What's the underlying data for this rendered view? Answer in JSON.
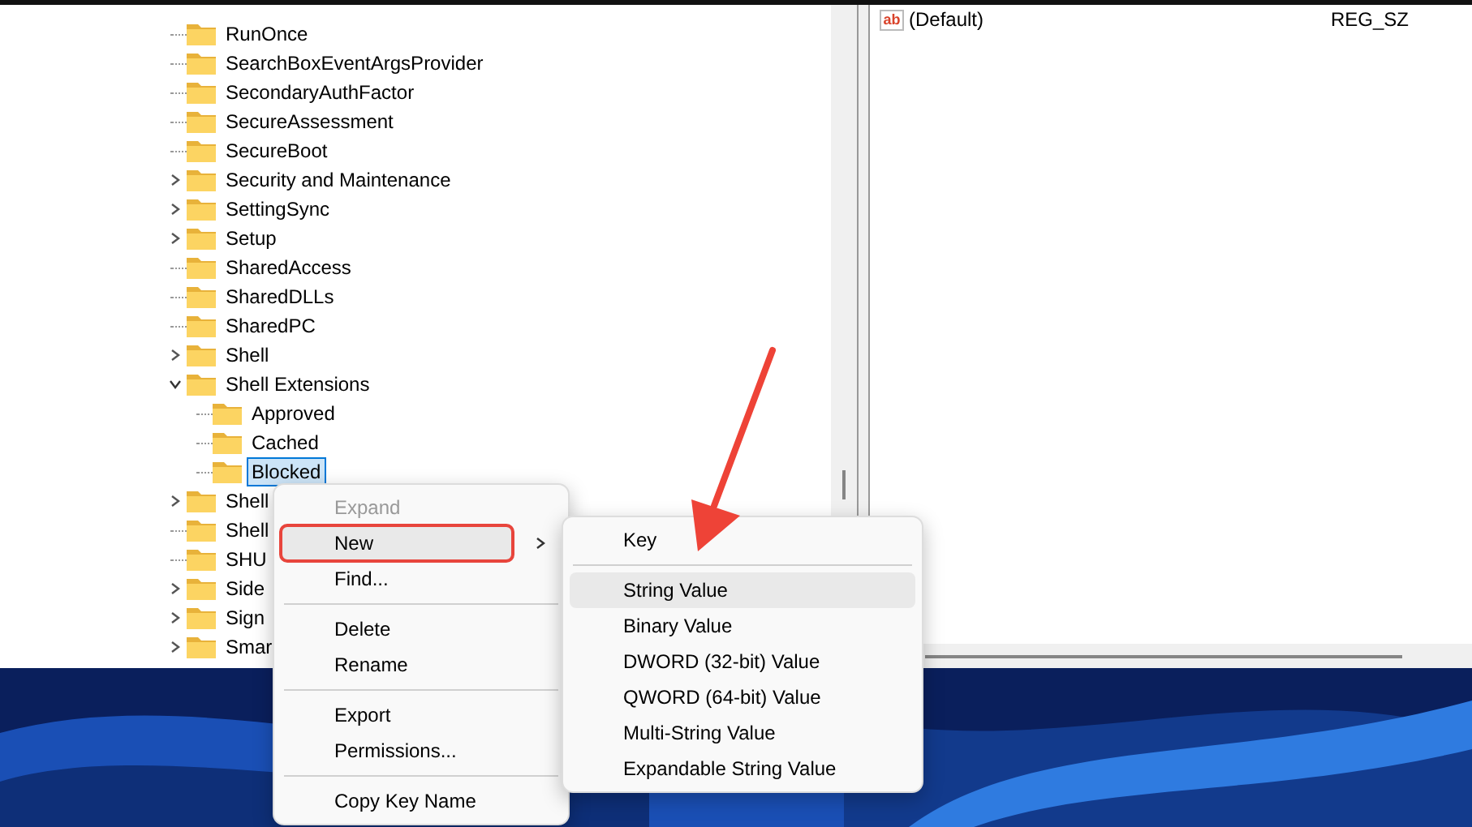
{
  "tree": {
    "items": [
      {
        "label": "RunOnce",
        "expandable": false,
        "selected": false
      },
      {
        "label": "SearchBoxEventArgsProvider",
        "expandable": false,
        "selected": false
      },
      {
        "label": "SecondaryAuthFactor",
        "expandable": false,
        "selected": false
      },
      {
        "label": "SecureAssessment",
        "expandable": false,
        "selected": false
      },
      {
        "label": "SecureBoot",
        "expandable": false,
        "selected": false
      },
      {
        "label": "Security and Maintenance",
        "expandable": true,
        "expanded": false,
        "selected": false
      },
      {
        "label": "SettingSync",
        "expandable": true,
        "expanded": false,
        "selected": false
      },
      {
        "label": "Setup",
        "expandable": true,
        "expanded": false,
        "selected": false
      },
      {
        "label": "SharedAccess",
        "expandable": false,
        "selected": false
      },
      {
        "label": "SharedDLLs",
        "expandable": false,
        "selected": false
      },
      {
        "label": "SharedPC",
        "expandable": false,
        "selected": false
      },
      {
        "label": "Shell",
        "expandable": true,
        "expanded": false,
        "selected": false
      },
      {
        "label": "Shell Extensions",
        "expandable": true,
        "expanded": true,
        "selected": false,
        "children": [
          {
            "label": "Approved",
            "expandable": false,
            "selected": false
          },
          {
            "label": "Cached",
            "expandable": false,
            "selected": false
          },
          {
            "label": "Blocked",
            "expandable": false,
            "selected": true
          }
        ]
      },
      {
        "label": "Shell",
        "expandable": true,
        "expanded": false,
        "selected": false
      },
      {
        "label": "Shell",
        "expandable": false,
        "selected": false
      },
      {
        "label": "SHU",
        "expandable": false,
        "selected": false
      },
      {
        "label": "Side",
        "expandable": true,
        "expanded": false,
        "selected": false
      },
      {
        "label": "Sign",
        "expandable": true,
        "expanded": false,
        "selected": false
      },
      {
        "label": "Smar",
        "expandable": true,
        "expanded": false,
        "selected": false
      }
    ]
  },
  "values": {
    "rows": [
      {
        "icon": "ab",
        "name": "(Default)",
        "type": "REG_SZ"
      }
    ]
  },
  "context_menu": {
    "items": [
      {
        "kind": "item",
        "label": "Expand",
        "disabled": true,
        "highlighted": false,
        "outlined": false,
        "submenu": false
      },
      {
        "kind": "item",
        "label": "New",
        "disabled": false,
        "highlighted": true,
        "outlined": true,
        "submenu": true
      },
      {
        "kind": "item",
        "label": "Find...",
        "disabled": false,
        "highlighted": false,
        "outlined": false,
        "submenu": false
      },
      {
        "kind": "separator"
      },
      {
        "kind": "item",
        "label": "Delete",
        "disabled": false,
        "highlighted": false,
        "outlined": false,
        "submenu": false
      },
      {
        "kind": "item",
        "label": "Rename",
        "disabled": false,
        "highlighted": false,
        "outlined": false,
        "submenu": false
      },
      {
        "kind": "separator"
      },
      {
        "kind": "item",
        "label": "Export",
        "disabled": false,
        "highlighted": false,
        "outlined": false,
        "submenu": false
      },
      {
        "kind": "item",
        "label": "Permissions...",
        "disabled": false,
        "highlighted": false,
        "outlined": false,
        "submenu": false
      },
      {
        "kind": "separator"
      },
      {
        "kind": "item",
        "label": "Copy Key Name",
        "disabled": false,
        "highlighted": false,
        "outlined": false,
        "submenu": false
      }
    ]
  },
  "submenu": {
    "items": [
      {
        "kind": "item",
        "label": "Key",
        "highlighted": false
      },
      {
        "kind": "separator"
      },
      {
        "kind": "item",
        "label": "String Value",
        "highlighted": true
      },
      {
        "kind": "item",
        "label": "Binary Value",
        "highlighted": false
      },
      {
        "kind": "item",
        "label": "DWORD (32-bit) Value",
        "highlighted": false
      },
      {
        "kind": "item",
        "label": "QWORD (64-bit) Value",
        "highlighted": false
      },
      {
        "kind": "item",
        "label": "Multi-String Value",
        "highlighted": false
      },
      {
        "kind": "item",
        "label": "Expandable String Value",
        "highlighted": false
      }
    ]
  },
  "annotations": [
    {
      "kind": "arrow"
    }
  ]
}
